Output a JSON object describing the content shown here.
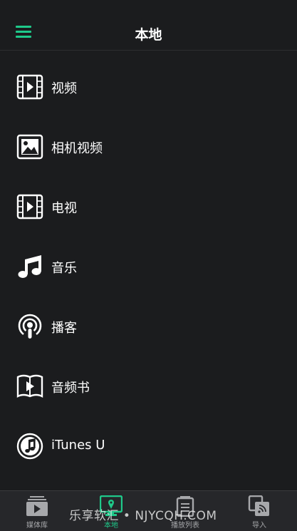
{
  "header": {
    "title": "本地"
  },
  "menu": [
    {
      "label": "视频",
      "icon": "video-icon"
    },
    {
      "label": "相机视频",
      "icon": "photo-icon"
    },
    {
      "label": "电视",
      "icon": "tv-icon"
    },
    {
      "label": "音乐",
      "icon": "music-note-icon"
    },
    {
      "label": "播客",
      "icon": "podcast-icon"
    },
    {
      "label": "音频书",
      "icon": "audiobook-icon"
    },
    {
      "label": "iTunes U",
      "icon": "itunes-u-icon"
    }
  ],
  "tabs": [
    {
      "label": "媒体库",
      "icon": "media-library-icon",
      "active": false
    },
    {
      "label": "本地",
      "icon": "local-icon",
      "active": true
    },
    {
      "label": "播放列表",
      "icon": "playlist-icon",
      "active": false
    },
    {
      "label": "导入",
      "icon": "import-icon",
      "active": false
    }
  ],
  "watermark": "乐享软汇 • NJYCQH.COM",
  "colors": {
    "accent": "#1fc98a",
    "background": "#1b1c1e",
    "tabbar": "#26272a"
  }
}
